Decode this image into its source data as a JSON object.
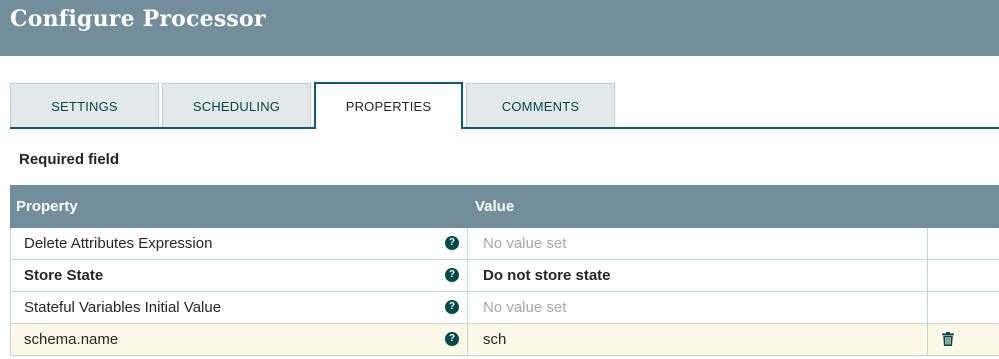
{
  "header": {
    "title": "Configure Processor"
  },
  "tabs": [
    {
      "label": "SETTINGS",
      "active": false
    },
    {
      "label": "SCHEDULING",
      "active": false
    },
    {
      "label": "PROPERTIES",
      "active": true
    },
    {
      "label": "COMMENTS",
      "active": false
    }
  ],
  "required_label": "Required field",
  "grid": {
    "columns": {
      "property": "Property",
      "value": "Value"
    },
    "rows": [
      {
        "name": "Delete Attributes Expression",
        "value": "No value set",
        "help_icon": "question-circle-icon"
      },
      {
        "name": "Store State",
        "value": "Do not store state",
        "help_icon": "question-circle-icon"
      },
      {
        "name": "Stateful Variables Initial Value",
        "value": "No value set",
        "help_icon": "question-circle-icon"
      },
      {
        "name": "schema.name",
        "value": "sch",
        "help_icon": "question-circle-icon",
        "action_icon": "trash-icon"
      }
    ]
  },
  "colors": {
    "header_bg": "#728e9b",
    "accent": "#004849",
    "highlight_row": "#fdf9e8"
  }
}
